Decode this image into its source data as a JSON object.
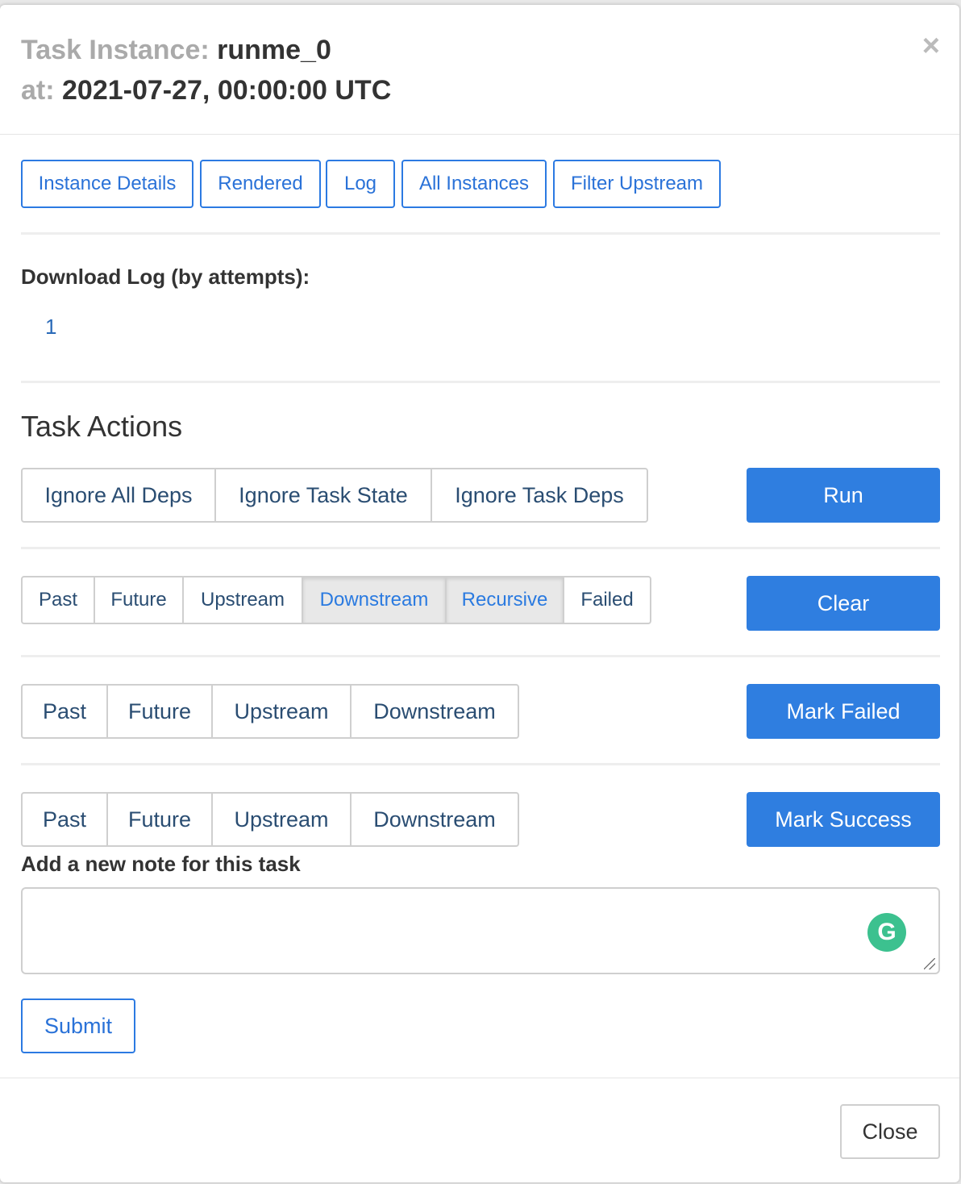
{
  "header": {
    "task_instance_label": "Task Instance:",
    "task_instance_value": "runme_0",
    "at_label": "at:",
    "at_value": "2021-07-27, 00:00:00 UTC",
    "close_symbol": "×"
  },
  "nav_buttons": [
    "Instance Details",
    "Rendered",
    "Log",
    "All Instances",
    "Filter Upstream"
  ],
  "download": {
    "label": "Download Log (by attempts):",
    "attempts": [
      "1"
    ]
  },
  "task_actions": {
    "title": "Task Actions",
    "run": {
      "options": [
        "Ignore All Deps",
        "Ignore Task State",
        "Ignore Task Deps"
      ],
      "button": "Run"
    },
    "clear": {
      "options": [
        "Past",
        "Future",
        "Upstream",
        "Downstream",
        "Recursive",
        "Failed"
      ],
      "active": [
        "Downstream",
        "Recursive"
      ],
      "button": "Clear"
    },
    "mark_failed": {
      "options": [
        "Past",
        "Future",
        "Upstream",
        "Downstream"
      ],
      "button": "Mark Failed"
    },
    "mark_success": {
      "options": [
        "Past",
        "Future",
        "Upstream",
        "Downstream"
      ],
      "button": "Mark Success"
    }
  },
  "note": {
    "label": "Add a new note for this task",
    "value": "",
    "grammarly_icon": "G",
    "submit": "Submit"
  },
  "footer": {
    "close": "Close"
  },
  "colors": {
    "primary": "#2f7ee0",
    "link": "#2a72d8",
    "active_toggle_bg": "#e8e8e8"
  }
}
